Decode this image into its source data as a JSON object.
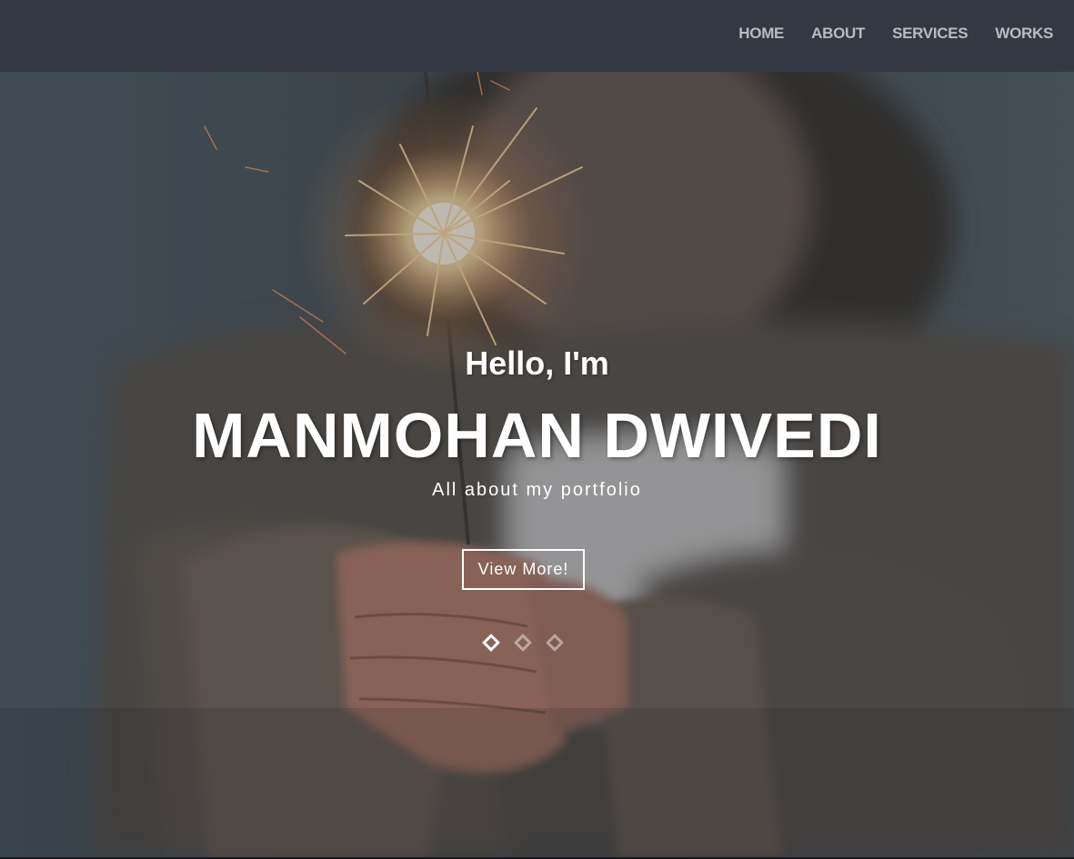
{
  "nav": {
    "items": [
      {
        "label": "HOME"
      },
      {
        "label": "ABOUT"
      },
      {
        "label": "SERVICES"
      },
      {
        "label": "WORKS"
      }
    ]
  },
  "hero": {
    "greeting": "Hello, I'm",
    "name": "MANMOHAN DWIVEDI",
    "tagline": "All about my portfolio",
    "button_label": "View More!",
    "slides_total": 3,
    "active_slide": 1,
    "photo_icon": "sparkler-photo"
  },
  "colors": {
    "navbar_bg": "#343842",
    "nav_text": "#b8bbc0",
    "hero_text": "#ffffff"
  }
}
